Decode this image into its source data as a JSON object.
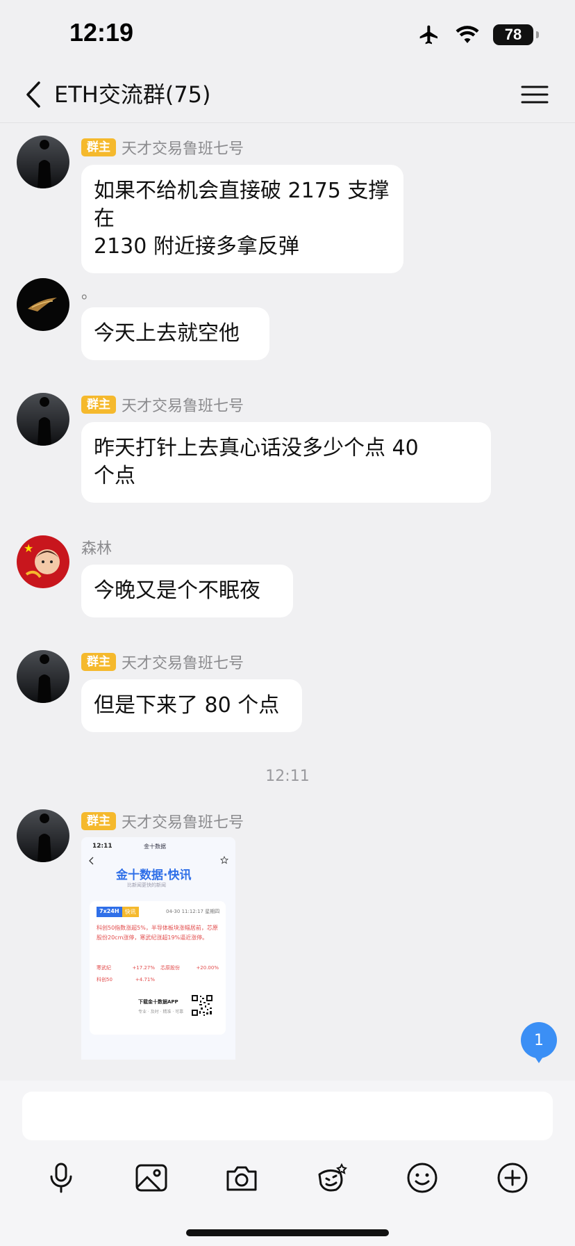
{
  "status": {
    "time": "12:19",
    "battery": "78"
  },
  "header": {
    "title": "ETH交流群(75)"
  },
  "messages": [
    {
      "badge": "群主",
      "sender": "天才交易鲁班七号",
      "text_lines": [
        "如果不给机会直接破 2175 支撑 在",
        "2130 附近接多拿反弹"
      ]
    },
    {
      "sender": "。",
      "text_lines": [
        "今天上去就空他"
      ]
    },
    {
      "badge": "群主",
      "sender": "天才交易鲁班七号",
      "text_lines": [
        "昨天打针上去真心话没多少个点  40",
        "个点"
      ]
    },
    {
      "sender": "森林",
      "text_lines": [
        "今晚又是个不眠夜"
      ]
    },
    {
      "badge": "群主",
      "sender": "天才交易鲁班七号",
      "text_lines": [
        "但是下来了 80 个点"
      ]
    }
  ],
  "timestamp": "12:11",
  "image_message": {
    "badge": "群主",
    "sender": "天才交易鲁班七号",
    "screenshot": {
      "status_time": "12:11",
      "status_title": "金十数据",
      "logo": "金十数据·快讯",
      "tagline": "比新闻更快的新闻",
      "tag1": "7x24H",
      "tag2": "快讯",
      "date": "04-30 11:12:17 星期四",
      "text": "科创50指数涨超5%，半导体板块涨幅居前，芯原股份20cm涨停，寒武纪涨超19%逼近涨停。",
      "rows": [
        {
          "name": "寒武纪",
          "value": "+17.27%"
        },
        {
          "name": "芯原股份",
          "value": "+20.00%"
        },
        {
          "name": "科创50",
          "value": "+4.71%"
        }
      ],
      "download": "下载金十数据APP",
      "download_sub": "专业 · 及时 · 精准 · 可靠"
    }
  },
  "unread_count": "1",
  "toolbar": [
    "microphone-icon",
    "image-icon",
    "camera-icon",
    "sticker-icon",
    "emoji-icon",
    "plus-icon"
  ]
}
